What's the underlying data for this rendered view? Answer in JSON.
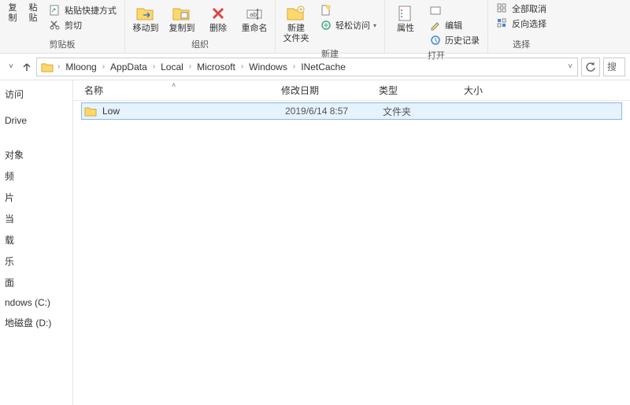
{
  "ribbon": {
    "clipboard": {
      "big1": "复制",
      "big2": "粘贴",
      "small1": "粘贴快捷方式",
      "small2": "剪切",
      "label": "剪贴板"
    },
    "organize": {
      "moveTo": "移动到",
      "copyTo": "复制到",
      "delete": "删除",
      "rename": "重命名",
      "label": "组织"
    },
    "new": {
      "newFolder": "新建\n文件夹",
      "easyAccess": "轻松访问",
      "label": "新建"
    },
    "open": {
      "properties": "属性",
      "edit": "编辑",
      "history": "历史记录",
      "label": "打开"
    },
    "select": {
      "selectAll": "全部取消",
      "invert": "反向选择",
      "label": "选择"
    }
  },
  "breadcrumb": {
    "items": [
      "Mloong",
      "AppData",
      "Local",
      "Microsoft",
      "Windows",
      "INetCache"
    ]
  },
  "searchPlaceholder": "搜",
  "sidebar": {
    "item0": "访问",
    "item1": "Drive",
    "item2": "",
    "item3": "对象",
    "item4": "频",
    "item5": "片",
    "item6": "当",
    "item7": "载",
    "item8": "乐",
    "item9": "面",
    "item10": "ndows (C:)",
    "item11": "地磁盘 (D:)"
  },
  "columns": {
    "name": "名称",
    "date": "修改日期",
    "type": "类型",
    "size": "大小"
  },
  "files": [
    {
      "name": "Low",
      "date": "2019/6/14 8:57",
      "type": "文件夹"
    }
  ]
}
